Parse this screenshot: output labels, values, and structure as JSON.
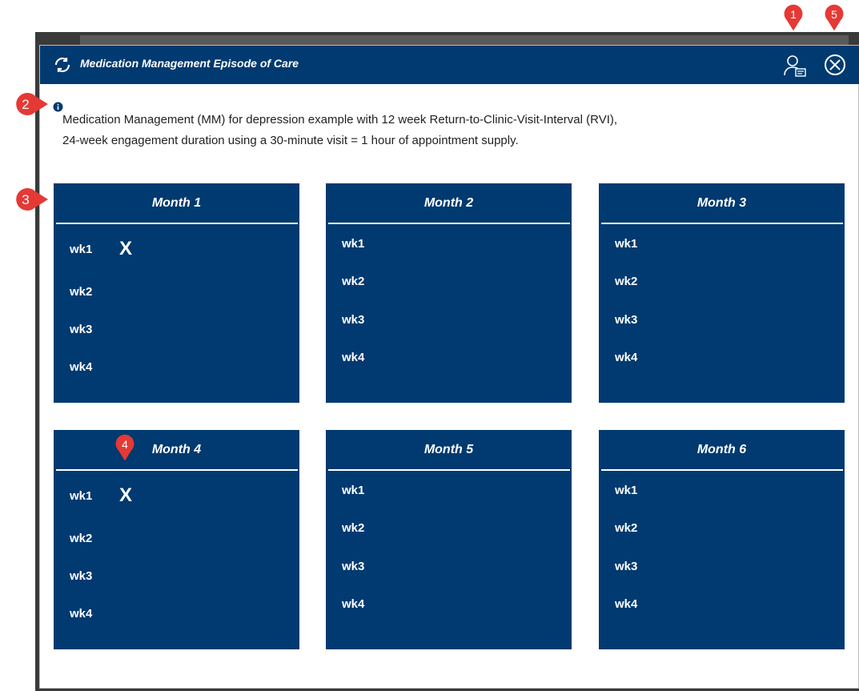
{
  "modal": {
    "title": "Medication Management Episode of Care",
    "description_line1": "Medication Management (MM) for depression example with 12 week Return-to-Clinic-Visit-Interval (RVI),",
    "description_line2": "24-week engagement duration using a 30-minute visit = 1 hour of appointment supply."
  },
  "months": [
    {
      "label": "Month 1",
      "weeks": [
        "wk1",
        "wk2",
        "wk3",
        "wk4"
      ],
      "mark": "X"
    },
    {
      "label": "Month 2",
      "weeks": [
        "wk1",
        "wk2",
        "wk3",
        "wk4"
      ],
      "mark": ""
    },
    {
      "label": "Month 3",
      "weeks": [
        "wk1",
        "wk2",
        "wk3",
        "wk4"
      ],
      "mark": ""
    },
    {
      "label": "Month 4",
      "weeks": [
        "wk1",
        "wk2",
        "wk3",
        "wk4"
      ],
      "mark": "X"
    },
    {
      "label": "Month 5",
      "weeks": [
        "wk1",
        "wk2",
        "wk3",
        "wk4"
      ],
      "mark": ""
    },
    {
      "label": "Month 6",
      "weeks": [
        "wk1",
        "wk2",
        "wk3",
        "wk4"
      ],
      "mark": ""
    }
  ],
  "callouts": [
    "1",
    "2",
    "3",
    "4",
    "5"
  ],
  "colors": {
    "header": "#003a70",
    "card": "#003a70",
    "callout": "#e53935"
  },
  "icons": {
    "refresh": "refresh-icon",
    "user": "user-card-icon",
    "close": "close-circle-icon",
    "info": "info-icon"
  }
}
